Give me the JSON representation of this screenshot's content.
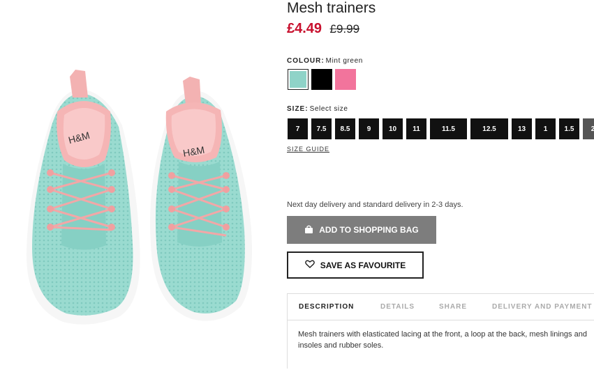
{
  "product": {
    "title": "Mesh trainers",
    "price_sale": "£4.49",
    "price_original": "£9.99"
  },
  "colour": {
    "label": "COLOUR:",
    "selected": "Mint green",
    "swatches": [
      {
        "name": "Mint green",
        "color": "#8fd3c8",
        "selected": true
      },
      {
        "name": "Black",
        "color": "#000000",
        "selected": false
      },
      {
        "name": "Pink",
        "color": "#f2749c",
        "selected": false
      }
    ]
  },
  "size": {
    "label": "SIZE:",
    "selected": "Select size",
    "options": [
      "7",
      "7.5",
      "8.5",
      "9",
      "10",
      "11",
      "11.5",
      "12.5",
      "13",
      "1",
      "1.5",
      "2"
    ],
    "guide_label": "SIZE GUIDE"
  },
  "delivery_text": "Next day delivery and standard delivery in 2-3 days.",
  "buttons": {
    "add_to_bag": "ADD TO SHOPPING BAG",
    "favourite": "SAVE AS FAVOURITE"
  },
  "tabs": [
    "DESCRIPTION",
    "DETAILS",
    "SHARE",
    "DELIVERY AND PAYMENT"
  ],
  "active_tab": "DESCRIPTION",
  "description": "Mesh trainers with elasticated lacing at the front, a loop at the back, mesh linings and insoles and rubber soles.",
  "colors": {
    "sale_price": "#c8102e",
    "add_button": "#7d7d7d",
    "size_button": "#111111"
  },
  "icons": {
    "add_to_bag": "shopping-bag-icon",
    "favourite": "heart-outline-icon"
  }
}
